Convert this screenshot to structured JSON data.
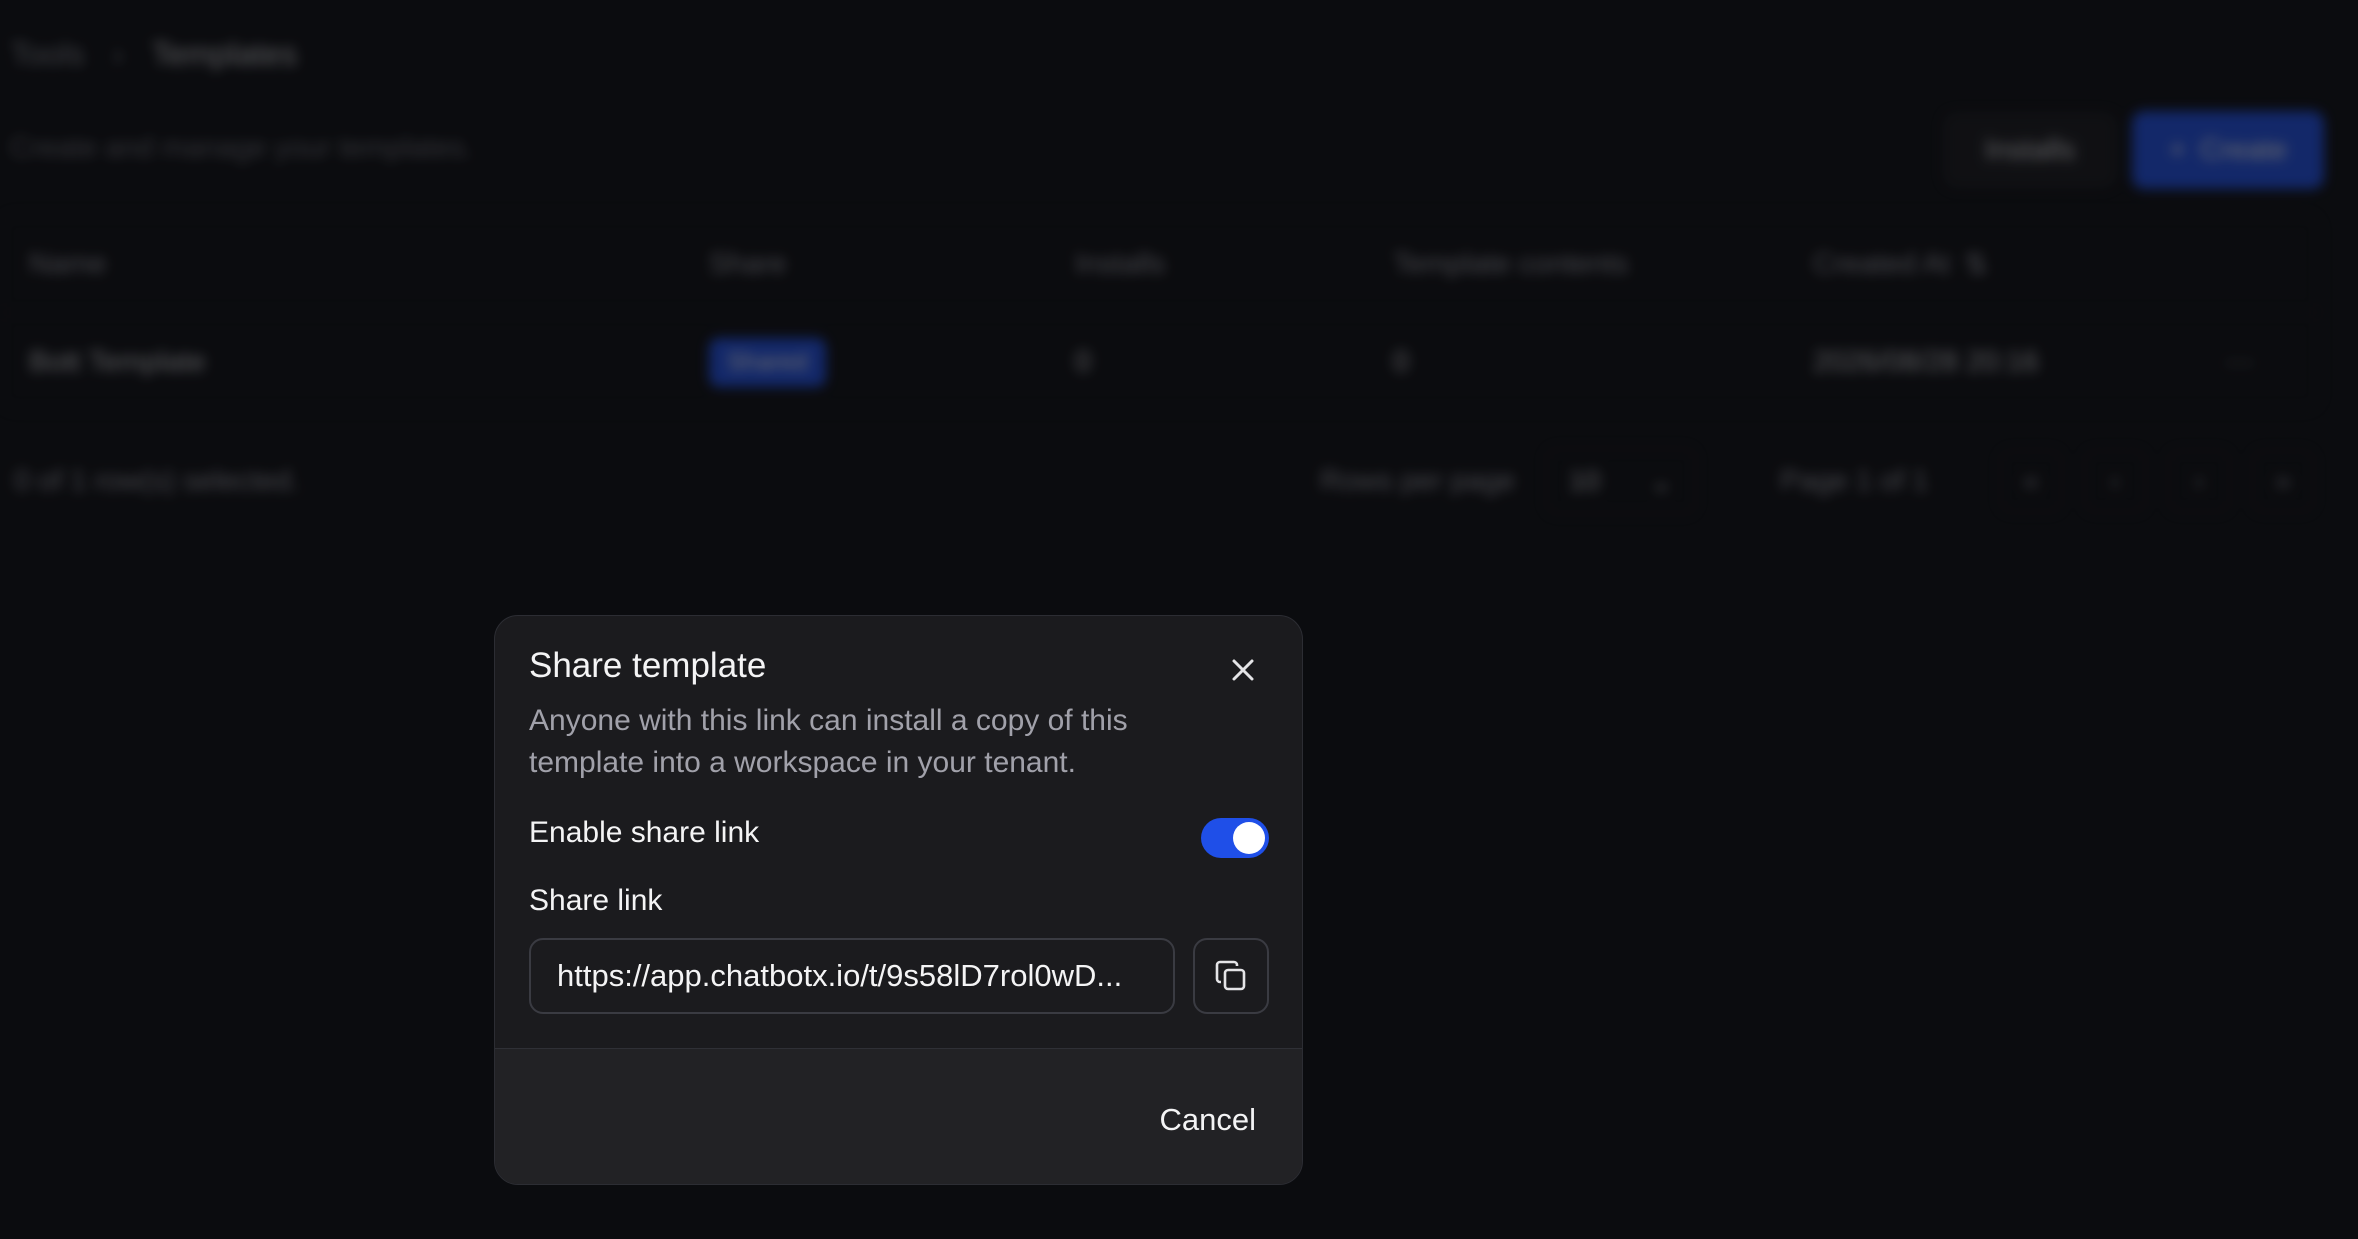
{
  "background": {
    "breadcrumb": {
      "parent": "Tools",
      "separator": "›",
      "current": "Templates"
    },
    "description": "Create and manage your templates.",
    "installs_button": "Installs",
    "create_button": "Create",
    "table": {
      "headers": [
        "Name",
        "Share",
        "Installs",
        "Template contents",
        "Created At"
      ],
      "rows": [
        {
          "name": "Bott Template",
          "share": "Shared",
          "installs": "0",
          "contents": "0",
          "created_at": "2026/08/28 20:16",
          "actions": "···"
        }
      ]
    },
    "footer": {
      "selected": "0 of 1 row(s) selected.",
      "rows_per_page_label": "Rows per page",
      "rows_per_page_value": "10",
      "page_info": "Page 1 of 1"
    }
  },
  "dialog": {
    "title": "Share template",
    "description": "Anyone with this link can install a copy of this template into a workspace in your tenant.",
    "toggle_label": "Enable share link",
    "toggle_enabled": true,
    "link_label": "Share link",
    "link_value": "https://app.chatbotx.io/t/9s58lD7rol0wD...",
    "cancel_label": "Cancel"
  },
  "colors": {
    "accent": "#2355f0",
    "dialog_bg": "#1b1b1e",
    "page_bg": "#0f1014"
  }
}
